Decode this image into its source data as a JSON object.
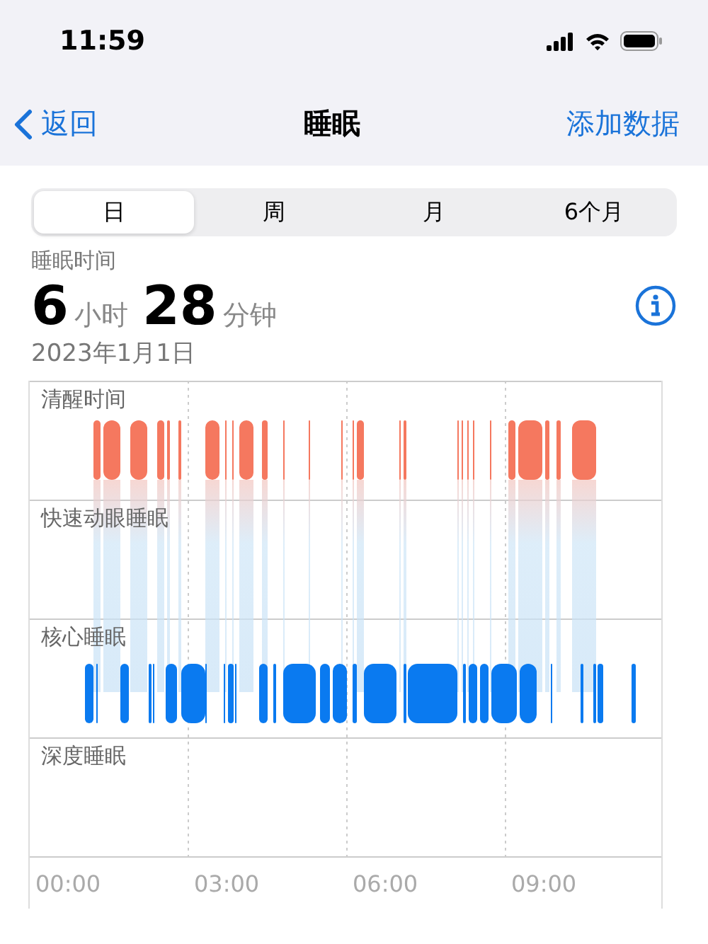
{
  "status_bar": {
    "time": "11:59"
  },
  "nav": {
    "back": "返回",
    "title": "睡眠",
    "action": "添加数据"
  },
  "tabs": [
    {
      "label": "日",
      "selected": true
    },
    {
      "label": "周",
      "selected": false
    },
    {
      "label": "月",
      "selected": false
    },
    {
      "label": "6个月",
      "selected": false
    }
  ],
  "summary": {
    "label": "睡眠时间",
    "hours": "6",
    "hours_unit": "小时",
    "minutes": "28",
    "minutes_unit": "分钟",
    "date": "2023年1月1日"
  },
  "chart": {
    "rows": [
      "清醒时间",
      "快速动眼睡眠",
      "核心睡眠",
      "深度睡眠"
    ],
    "x_labels": [
      "00:00",
      "03:00",
      "06:00",
      "09:00"
    ]
  }
}
